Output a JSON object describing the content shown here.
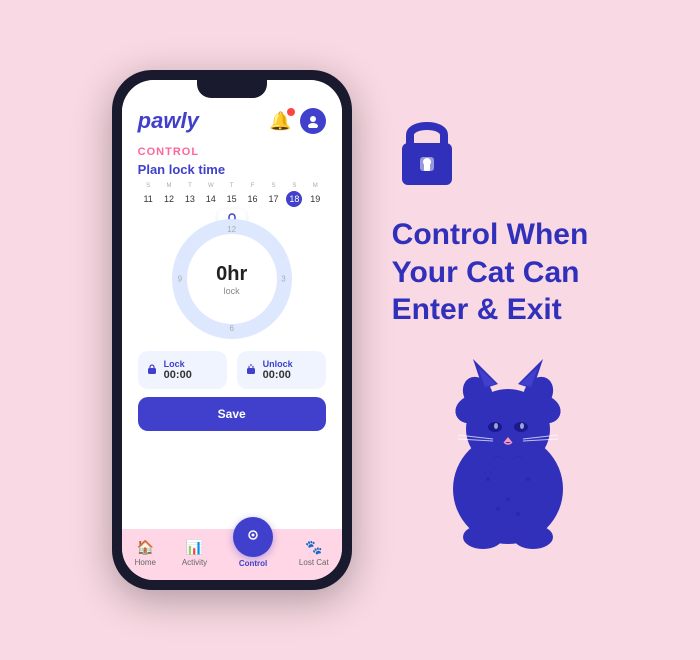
{
  "app": {
    "logo": "pawly",
    "header_bell": "🔔",
    "header_user": "👤"
  },
  "control": {
    "section_label": "CONTROL",
    "plan_lock_title": "Plan lock time",
    "calendar": {
      "days": [
        {
          "name": "S",
          "num": "11"
        },
        {
          "name": "M",
          "num": "12"
        },
        {
          "name": "T",
          "num": "13"
        },
        {
          "name": "W",
          "num": "14"
        },
        {
          "name": "T",
          "num": "15"
        },
        {
          "name": "F",
          "num": "16"
        },
        {
          "name": "S",
          "num": "17"
        },
        {
          "name": "S",
          "num": "18",
          "selected": true
        },
        {
          "name": "M",
          "num": "19"
        }
      ]
    },
    "clock": {
      "time": "0hr",
      "label": "lock",
      "numbers": {
        "top": "12",
        "right": "3",
        "bottom": "6",
        "left": "9"
      }
    },
    "lock_btn": {
      "label": "Lock",
      "value": "00:00"
    },
    "unlock_btn": {
      "label": "Unlock",
      "value": "00:00"
    },
    "save_label": "Save"
  },
  "nav": {
    "items": [
      {
        "label": "Home",
        "icon": "🏠",
        "active": false
      },
      {
        "label": "Activity",
        "icon": "📊",
        "active": false
      },
      {
        "label": "Control",
        "icon": "📷",
        "active": true,
        "center": true
      },
      {
        "label": "Lost Cat",
        "icon": "🐱",
        "active": false
      }
    ]
  },
  "tagline": {
    "line1": "Control When",
    "line2": "Your Cat Can",
    "line3": "Enter & Exit"
  },
  "lock_icon": "🔒",
  "colors": {
    "brand_blue": "#4040cc",
    "brand_pink": "#ff6699",
    "bg_pink": "#f9d9e3"
  }
}
